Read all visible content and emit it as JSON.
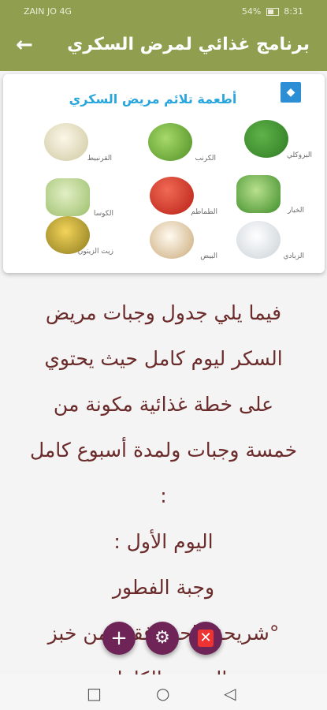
{
  "status": {
    "carrier": "ZAIN JO",
    "signal": "4G",
    "battery": "54%",
    "time": "8:31"
  },
  "header": {
    "title": "برنامج غذائي لمرض السكري",
    "back_icon": "arrow-left-icon"
  },
  "card": {
    "title": "أطعمة تلائم مريض السكري",
    "foods": [
      {
        "label": "البروكلي",
        "color": "#3e8e2e"
      },
      {
        "label": "الكرنب",
        "color": "#7fbf3f"
      },
      {
        "label": "القرنبيط",
        "color": "#e8e4c8"
      },
      {
        "label": "الخيار",
        "color": "#6db84a"
      },
      {
        "label": "الطماطم",
        "color": "#d63a2a"
      },
      {
        "label": "الكوسا",
        "color": "#b9d68a"
      },
      {
        "label": "الزبادي",
        "color": "#e9eef2"
      },
      {
        "label": "البيض",
        "color": "#f1ede4"
      },
      {
        "label": "زيت الزيتون",
        "color": "#c9a22a"
      }
    ]
  },
  "content": {
    "lines": [
      "فيما يلي جدول وجبات مريض",
      "السكر ليوم كامل حيث يحتوي",
      "على خطة غذائية مكونة من",
      "خمسة وجبات ولمدة أسبوع كامل",
      ":",
      "اليوم الأول :",
      "وجبة الفطور",
      "°شريحة واحدة فقط من خبز",
      "الحبوب الكاملة."
    ]
  },
  "fabs": {
    "add": "+",
    "settings": "⚙",
    "delete": "✕"
  },
  "colors": {
    "primary": "#8f9f4f",
    "accent": "#6e2457",
    "text": "#6b2b2b",
    "card_title": "#29a6dd"
  }
}
